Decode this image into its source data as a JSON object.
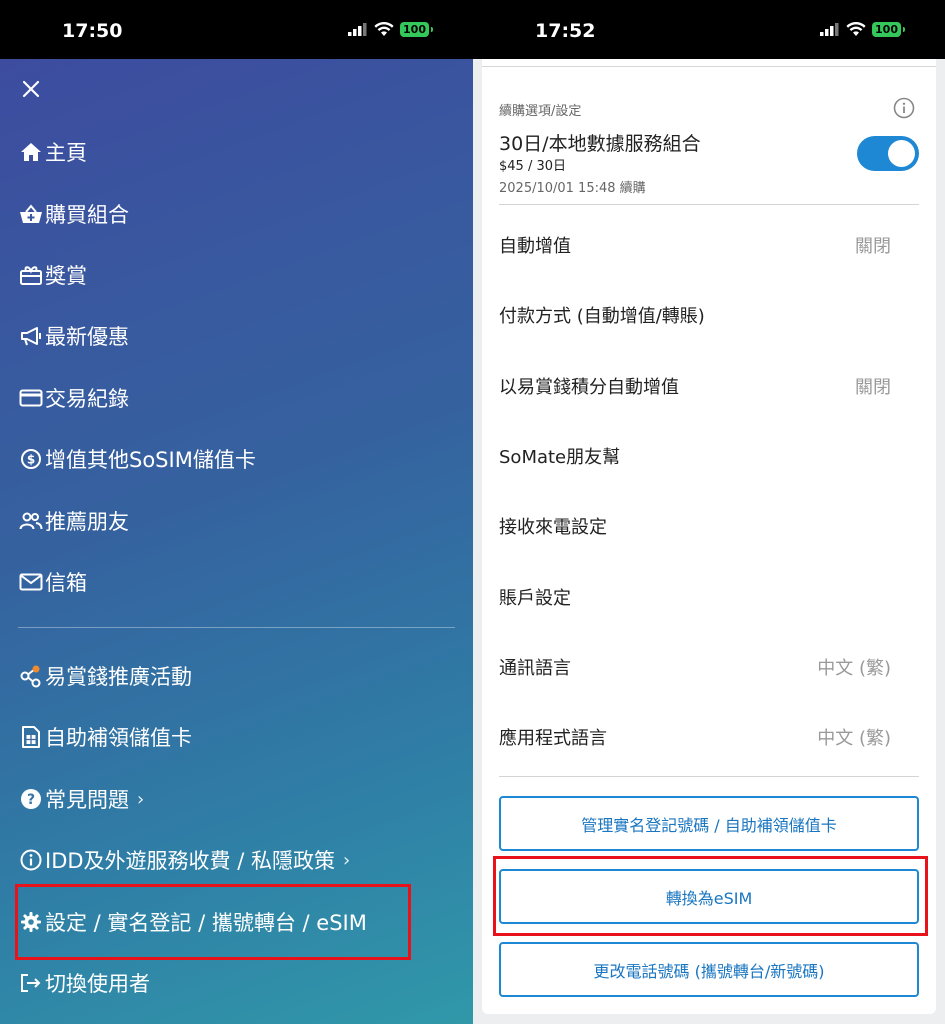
{
  "left": {
    "time": "17:50",
    "battery": "100",
    "menu": {
      "items": [
        {
          "label": "主頁",
          "icon": "home-icon"
        },
        {
          "label": "購買組合",
          "icon": "basket-icon"
        },
        {
          "label": "獎賞",
          "icon": "gift-icon"
        },
        {
          "label": "最新優惠",
          "icon": "megaphone-icon"
        },
        {
          "label": "交易紀錄",
          "icon": "card-icon"
        },
        {
          "label": "增值其他SoSIM儲值卡",
          "icon": "coin-icon"
        },
        {
          "label": "推薦朋友",
          "icon": "people-icon"
        },
        {
          "label": "信箱",
          "icon": "mail-icon"
        }
      ],
      "items2": [
        {
          "label": "易賞錢推廣活動",
          "icon": "share-icon"
        },
        {
          "label": "自助補領儲值卡",
          "icon": "sim-icon"
        },
        {
          "label": "常見問題",
          "icon": "help-icon",
          "chevron": "›"
        },
        {
          "label": "IDD及外遊服務收費 / 私隱政策",
          "icon": "info-icon",
          "chevron": "›"
        },
        {
          "label": "設定 / 實名登記 / 攜號轉台 / eSIM",
          "icon": "gear-icon"
        },
        {
          "label": "切換使用者",
          "icon": "switch-user-icon"
        }
      ]
    }
  },
  "right": {
    "time": "17:52",
    "battery": "100",
    "renewal": {
      "label": "續購選項/設定",
      "plan_title": "30日/本地數據服務組合",
      "price": "$45 / 30日",
      "date": "2025/10/01 15:48 續購",
      "toggle_on": true
    },
    "rows": [
      {
        "label": "自動增值",
        "value": "關閉"
      },
      {
        "label": "付款方式 (自動增值/轉賬)",
        "value": ""
      },
      {
        "label": "以易賞錢積分自動增值",
        "value": "關閉"
      },
      {
        "label": "SoMate朋友幫",
        "value": ""
      },
      {
        "label": "接收來電設定",
        "value": ""
      },
      {
        "label": "賬戶設定",
        "value": ""
      },
      {
        "label": "通訊語言",
        "value": "中文 (繁)"
      },
      {
        "label": "應用程式語言",
        "value": "中文 (繁)"
      }
    ],
    "buttons": {
      "manage": "管理實名登記號碼 / 自助補領儲值卡",
      "esim": "轉換為eSIM",
      "change_number": "更改電話號碼 (攜號轉台/新號碼)"
    }
  },
  "colors": {
    "accent": "#1e88d4",
    "highlight": "#e8121a",
    "battery": "#34c759"
  }
}
